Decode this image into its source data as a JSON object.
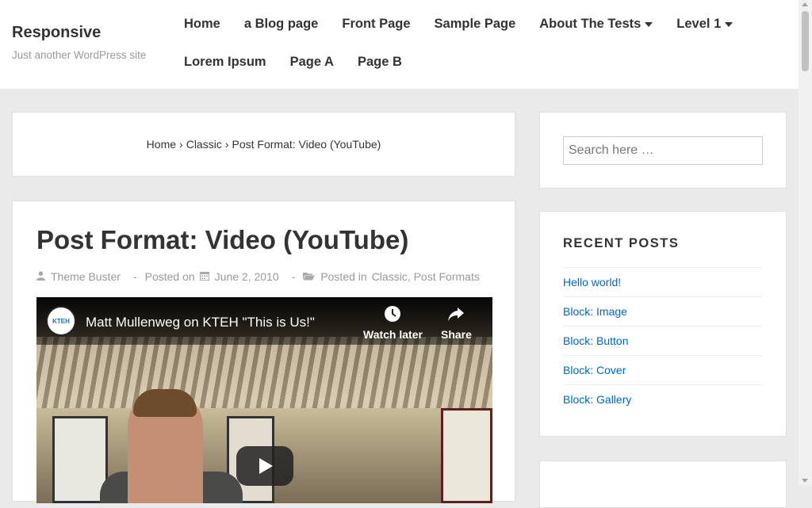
{
  "site": {
    "title": "Responsive",
    "tagline": "Just another WordPress site"
  },
  "nav": {
    "row1": [
      "Home",
      "a Blog page",
      "Front Page",
      "Sample Page",
      "About The Tests",
      "Level 1"
    ],
    "row2": [
      "Lorem Ipsum",
      "Page A",
      "Page B"
    ],
    "dropdown_items": [
      "About The Tests",
      "Level 1"
    ]
  },
  "breadcrumb": {
    "home": "Home",
    "sep": "›",
    "category": "Classic",
    "current": "Post Format: Video (YouTube)"
  },
  "post": {
    "title": "Post Format: Video (YouTube)",
    "author": "Theme Buster",
    "posted_on_label": "Posted on",
    "date": "June 2, 2010",
    "posted_in_label": "Posted in",
    "category_1": "Classic",
    "category_sep": ",",
    "category_2": "Post Formats",
    "dash": "-"
  },
  "video": {
    "title": "Matt Mullenweg on KTEH \"This is Us!\"",
    "channel": "KTEH",
    "watch_later": "Watch later",
    "share": "Share"
  },
  "sidebar": {
    "search_placeholder": "Search here …",
    "recent_posts_title": "RECENT POSTS",
    "recent_posts": [
      "Hello world!",
      "Block: Image",
      "Block: Button",
      "Block: Cover",
      "Block: Gallery"
    ]
  },
  "colors": {
    "link": "#0066cc",
    "background": "#eaeaea",
    "text": "#333333"
  }
}
